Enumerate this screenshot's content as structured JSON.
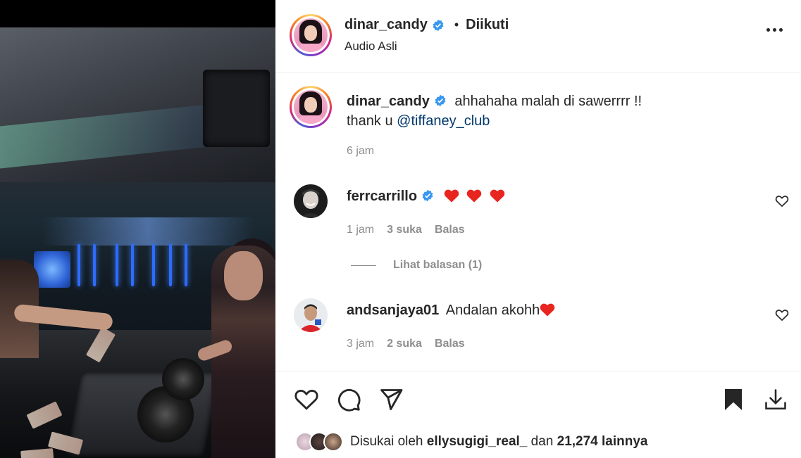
{
  "post": {
    "username": "dinar_candy",
    "follow_status": "Diikuti",
    "audio": "Audio Asli",
    "more_icon": "more-horizontal-icon"
  },
  "caption": {
    "username": "dinar_candy",
    "text_line1": "ahhahaha malah di sawerrrr !!",
    "text_prefix": "thank u ",
    "mention": "@tiffaney_club",
    "time": "6 jam"
  },
  "comments": [
    {
      "username": "ferrcarrillo",
      "verified": true,
      "text": "",
      "time": "1 jam",
      "likes": "3 suka",
      "reply_label": "Balas",
      "view_replies": "Lihat balasan (1)"
    },
    {
      "username": "andsanjaya01",
      "verified": false,
      "text": "Andalan akohh",
      "time": "3 jam",
      "likes": "2 suka",
      "reply_label": "Balas"
    }
  ],
  "likes": {
    "prefix": "Disukai oleh",
    "user": "ellysugigi_real_",
    "joiner": "dan",
    "count": "21,274 lainnya"
  },
  "icons": {
    "like": "heart-icon",
    "comment": "comment-icon",
    "share": "send-icon",
    "save": "bookmark-icon",
    "download": "download-icon"
  },
  "colors": {
    "verified": "#3897f0",
    "heart_emoji": "#e8251f",
    "mention": "#00376b",
    "muted": "#8e8e8e"
  }
}
